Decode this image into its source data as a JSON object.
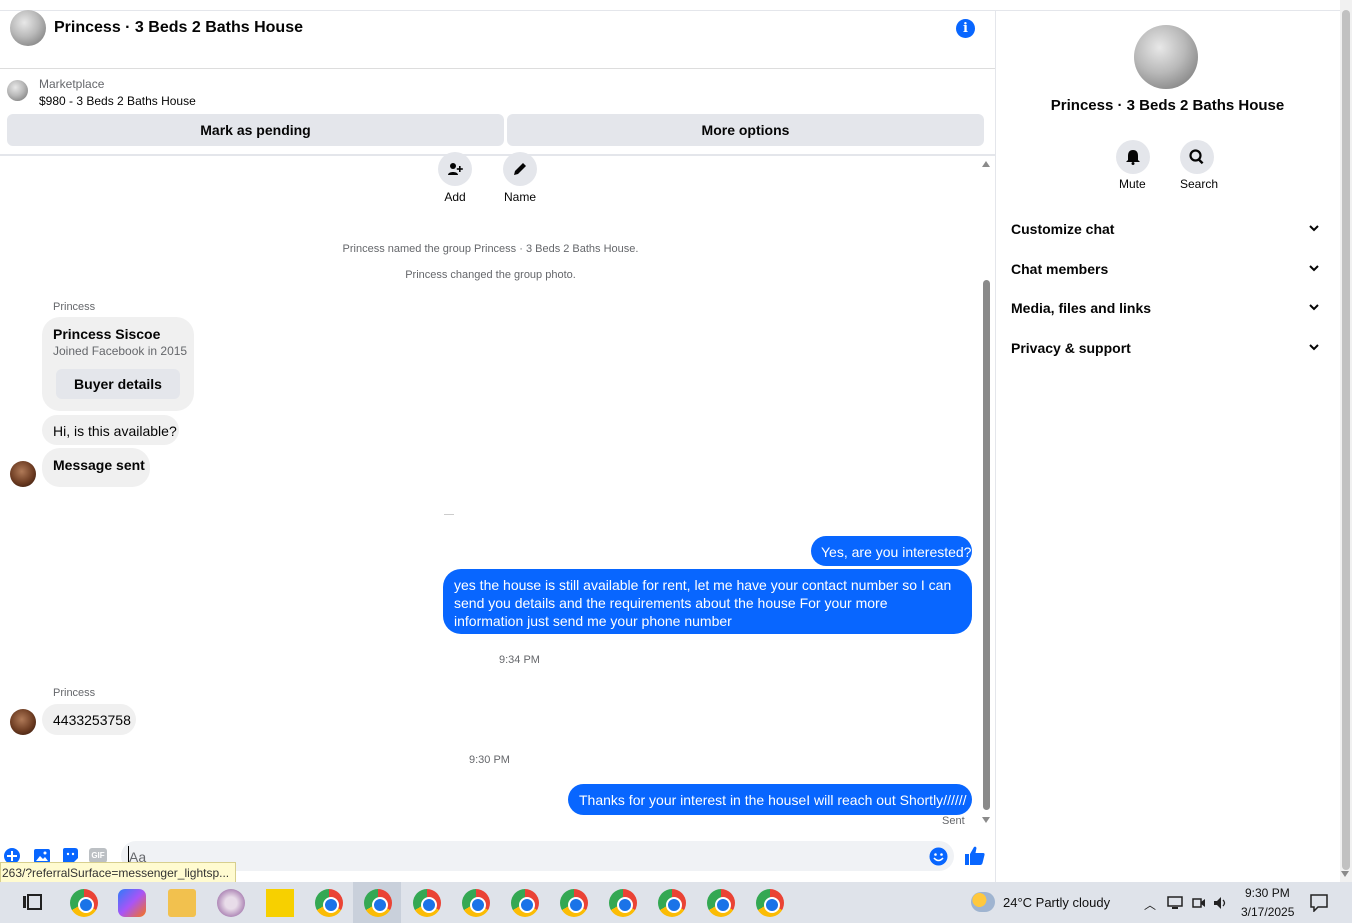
{
  "header": {
    "title": "Princess · 3 Beds 2 Baths House"
  },
  "marketplace": {
    "label": "Marketplace",
    "listing": "$980 - 3 Beds 2 Baths House",
    "pending_label": "Mark as pending",
    "more_label": "More options"
  },
  "group_actions": {
    "add_label": "Add",
    "name_label": "Name"
  },
  "system": {
    "named": "Princess named the group Princess · 3 Beds 2 Baths House.",
    "photo": "Princess changed the group photo."
  },
  "messages": {
    "sender1": "Princess",
    "buyer_name": "Princess Siscoe",
    "buyer_joined": "Joined Facebook in 2015",
    "buyer_details_label": "Buyer details",
    "in1": "Hi, is this available?",
    "in2": "Message sent",
    "out1": "Yes, are you interested?",
    "out2": "yes the house is still available for rent, let me have your contact number so I can send you details and the requirements about the house For  your  more  information  just send  me   your  phone  number",
    "time1": "9:34 PM",
    "sender2": "Princess",
    "in3": "4433253758",
    "time2": "9:30 PM",
    "out3": "Thanks for your interest in the houseI will reach out Shortly//////",
    "sent_label": "Sent"
  },
  "composer": {
    "placeholder": "Aa"
  },
  "status_url": "263/?referralSurface=messenger_lightsp...",
  "right_panel": {
    "title": "Princess · 3 Beds 2 Baths House",
    "mute_label": "Mute",
    "search_label": "Search",
    "sections": [
      "Customize chat",
      "Chat members",
      "Media, files and links",
      "Privacy & support"
    ]
  },
  "taskbar": {
    "weather": "24°C  Partly cloudy",
    "time": "9:30 PM",
    "date": "3/17/2025"
  },
  "colors": {
    "accent": "#0866ff",
    "bubble_in": "#f0f0f0"
  }
}
